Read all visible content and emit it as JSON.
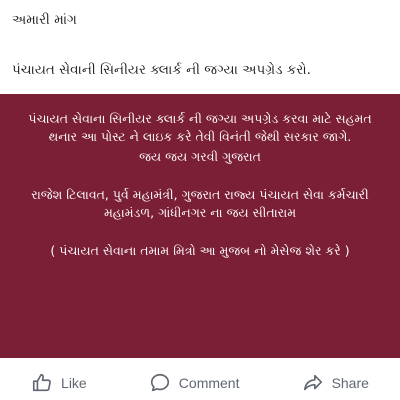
{
  "post": {
    "header": "અમારી માંગ",
    "text": "પંચાયત સેવાની સિનીયર ક્લાર્ક ની જગ્યા અપગ્રેડ કરો."
  },
  "banner": {
    "background": "#7b1f36",
    "para1": "પંચાયત સેવાના સિનીયર ક્લાર્ક ની જગ્યા અપગ્રેડ કરવા માટે સહમત થનાર આ પોસ્ટ ને લાઇક કરે તેવી વિનંતી જેથી સરકાર જાગે.",
    "slogan": "જય જય ગરવી ગુજરાત",
    "para2": "રાજેશ ટિલાવત, પુર્વ મહામંત્રી, ગુજરાત રાજ્ય પંચાયત સેવા કર્મચારી મહામંડળ, ગાંધીનગર ના જય સીતારામ",
    "para3": "( પંચાયત સેવાના તમામ મિત્રો આ મુજબ નો મેસેજ શેર કરે )"
  },
  "actions": {
    "like_label": "Like",
    "like_icon": "thumbs-up-icon",
    "comment_label": "Comment",
    "comment_icon": "speech-bubble-icon",
    "share_label": "Share",
    "share_icon": "share-arrow-icon"
  }
}
